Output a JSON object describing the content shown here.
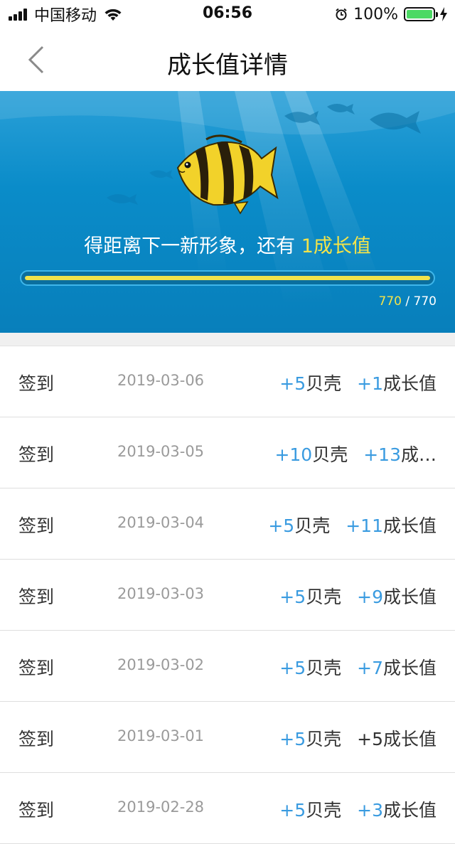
{
  "status_bar": {
    "carrier": "中国移动",
    "time": "06:56",
    "battery": "100%"
  },
  "nav": {
    "title": "成长值详情",
    "back_icon": "chevron-left-icon"
  },
  "banner": {
    "text_prefix": "得距离下一新形象，还有 ",
    "text_highlight": "1成长值",
    "progress_current": "770",
    "progress_separator": " / ",
    "progress_total": "770",
    "progress_ratio": 1.0,
    "colors": {
      "highlight": "#f2e34a",
      "bg": "#0a8cc9"
    }
  },
  "records": [
    {
      "label": "签到",
      "date": "2019-03-06",
      "shell_num": "+5",
      "shell_unit": "贝壳",
      "growth_num": "+1",
      "growth_unit": "成长值",
      "growth_plain": false
    },
    {
      "label": "签到",
      "date": "2019-03-05",
      "shell_num": "+10",
      "shell_unit": "贝壳",
      "growth_num": "+13",
      "growth_unit": "成…",
      "growth_plain": false
    },
    {
      "label": "签到",
      "date": "2019-03-04",
      "shell_num": "+5",
      "shell_unit": "贝壳",
      "growth_num": "+11",
      "growth_unit": "成长值",
      "growth_plain": false
    },
    {
      "label": "签到",
      "date": "2019-03-03",
      "shell_num": "+5",
      "shell_unit": "贝壳",
      "growth_num": "+9",
      "growth_unit": "成长值",
      "growth_plain": false
    },
    {
      "label": "签到",
      "date": "2019-03-02",
      "shell_num": "+5",
      "shell_unit": "贝壳",
      "growth_num": "+7",
      "growth_unit": "成长值",
      "growth_plain": false
    },
    {
      "label": "签到",
      "date": "2019-03-01",
      "shell_num": "+5",
      "shell_unit": "贝壳",
      "growth_num": "+5",
      "growth_unit": "成长值",
      "growth_plain": true
    },
    {
      "label": "签到",
      "date": "2019-02-28",
      "shell_num": "+5",
      "shell_unit": "贝壳",
      "growth_num": "+3",
      "growth_unit": "成长值",
      "growth_plain": false
    }
  ],
  "colors": {
    "accent": "#3a9be0",
    "text": "#333333",
    "date": "#9a9a9a"
  }
}
